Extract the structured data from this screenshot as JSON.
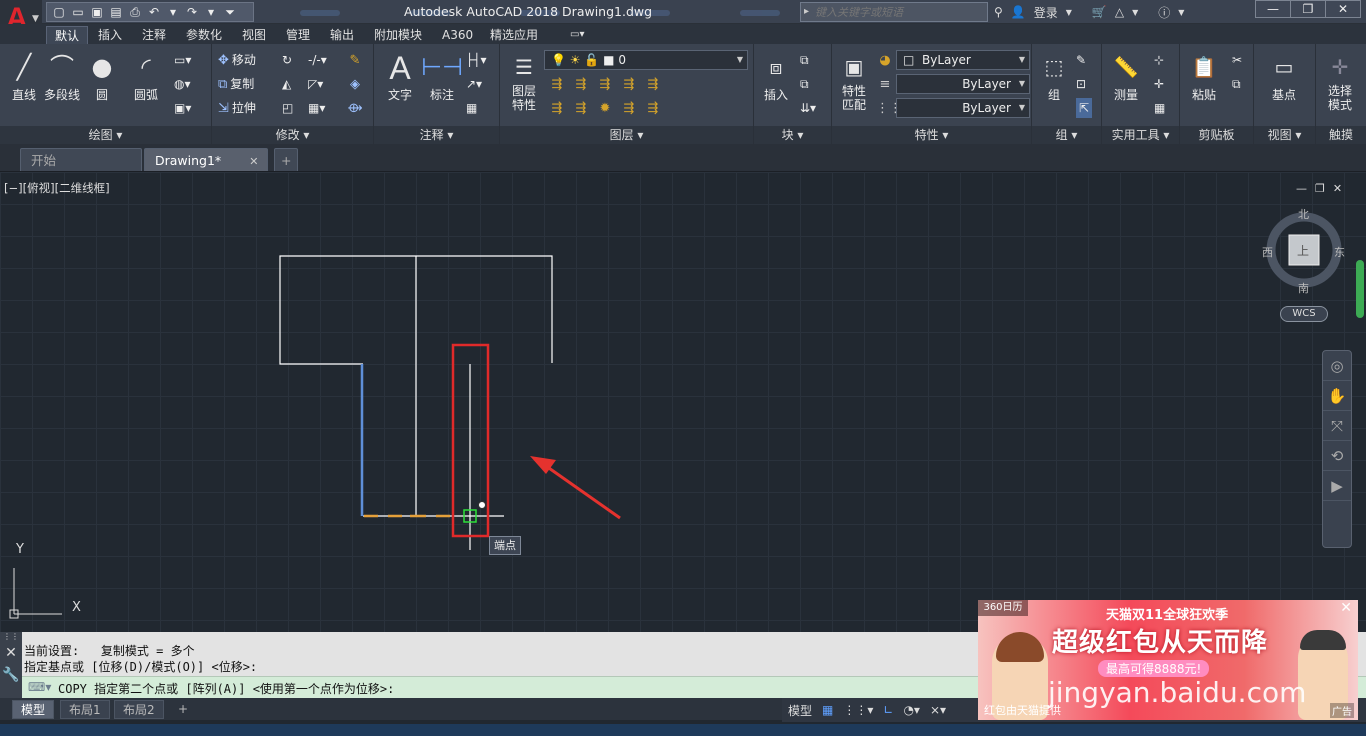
{
  "app": {
    "logo_letter": "A",
    "title": "Autodesk AutoCAD 2018    Drawing1.dwg"
  },
  "search": {
    "placeholder": "键入关键字或短语",
    "login": "登录"
  },
  "window_controls": [
    "—",
    "❐",
    "✕"
  ],
  "ribbon_tabs": [
    "默认",
    "插入",
    "注释",
    "参数化",
    "视图",
    "管理",
    "输出",
    "附加模块",
    "A360",
    "精选应用"
  ],
  "panels": {
    "draw": {
      "title": "绘图 ▾",
      "line": "直线",
      "polyline": "多段线",
      "circle": "圆",
      "arc": "圆弧"
    },
    "modify": {
      "title": "修改 ▾",
      "move": "移动",
      "copy": "复制",
      "stretch": "拉伸"
    },
    "annotation": {
      "title": "注释 ▾",
      "text": "文字",
      "dim": "标注"
    },
    "layers": {
      "title": "图层 ▾",
      "props_l1": "图层",
      "props_l2": "特性",
      "current_layer": "0"
    },
    "block": {
      "title": "块 ▾",
      "insert": "插入"
    },
    "properties": {
      "title": "特性 ▾",
      "match_l1": "特性",
      "match_l2": "匹配",
      "color": "ByLayer",
      "linetype": "ByLayer",
      "lineweight": "ByLayer"
    },
    "groups": {
      "title": "组 ▾",
      "group": "组"
    },
    "utilities": {
      "title": "实用工具 ▾",
      "measure": "测量"
    },
    "clipboard": {
      "title": "剪贴板",
      "paste": "粘贴"
    },
    "view": {
      "title": "视图 ▾",
      "base": "基点"
    },
    "touch": {
      "title": "触摸",
      "select_l1": "选择",
      "select_l2": "模式"
    }
  },
  "file_tabs": {
    "start": "开始",
    "drawing": "Drawing1*",
    "close": "✕",
    "add": "+"
  },
  "viewport": {
    "label": "[−][俯视][二维线框]",
    "ctrl_min": "—",
    "ctrl_restore": "❐",
    "ctrl_close": "✕"
  },
  "viewcube": {
    "north": "北",
    "south": "南",
    "east": "东",
    "west": "西",
    "face": "上",
    "wcs": "WCS"
  },
  "snap_tooltip": "端点",
  "ucs": {
    "x": "X",
    "y": "Y"
  },
  "command": {
    "line1": "当前设置:   复制模式 = 多个",
    "line2": "指定基点或 [位移(D)/模式(O)] <位移>:",
    "input": "COPY 指定第二个点或 [阵列(A)] <使用第一个点作为位移>:"
  },
  "layout_tabs": [
    "模型",
    "布局1",
    "布局2",
    "+"
  ],
  "status": {
    "model": "模型"
  },
  "ad": {
    "calendar": "360日历",
    "brand": "天猫双11全球狂欢季",
    "headline": "超级红包从天而降",
    "sub": "最高可得8888元!",
    "watermark": "jingyan.baidu.com",
    "footer": "红包由天猫提供",
    "ad_label": "广告",
    "close": "✕"
  }
}
